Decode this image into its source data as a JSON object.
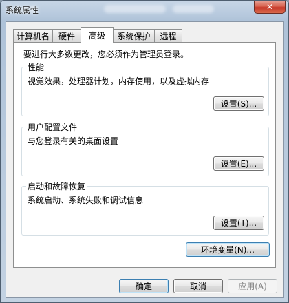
{
  "window": {
    "title": "系统属性",
    "close_glyph": "✕"
  },
  "tabs": [
    {
      "label": "计算机名",
      "active": false
    },
    {
      "label": "硬件",
      "active": false
    },
    {
      "label": "高级",
      "active": true
    },
    {
      "label": "系统保护",
      "active": false
    },
    {
      "label": "远程",
      "active": false
    }
  ],
  "advanced": {
    "admin_notice": "要进行大多数更改，您必须作为管理员登录。",
    "performance": {
      "title": "性能",
      "description": "视觉效果，处理器计划，内存使用，以及虚拟内存",
      "button": "设置(S)..."
    },
    "user_profiles": {
      "title": "用户配置文件",
      "description": "与您登录有关的桌面设置",
      "button": "设置(E)..."
    },
    "startup_recovery": {
      "title": "启动和故障恢复",
      "description": "系统启动、系统失败和调试信息",
      "button": "设置(T)..."
    },
    "env_button": "环境变量(N)..."
  },
  "footer": {
    "ok": "确定",
    "cancel": "取消",
    "apply": "应用(A)"
  },
  "colors": {
    "close_button": "#c7392a",
    "default_button_border": "#3c7fb1"
  }
}
